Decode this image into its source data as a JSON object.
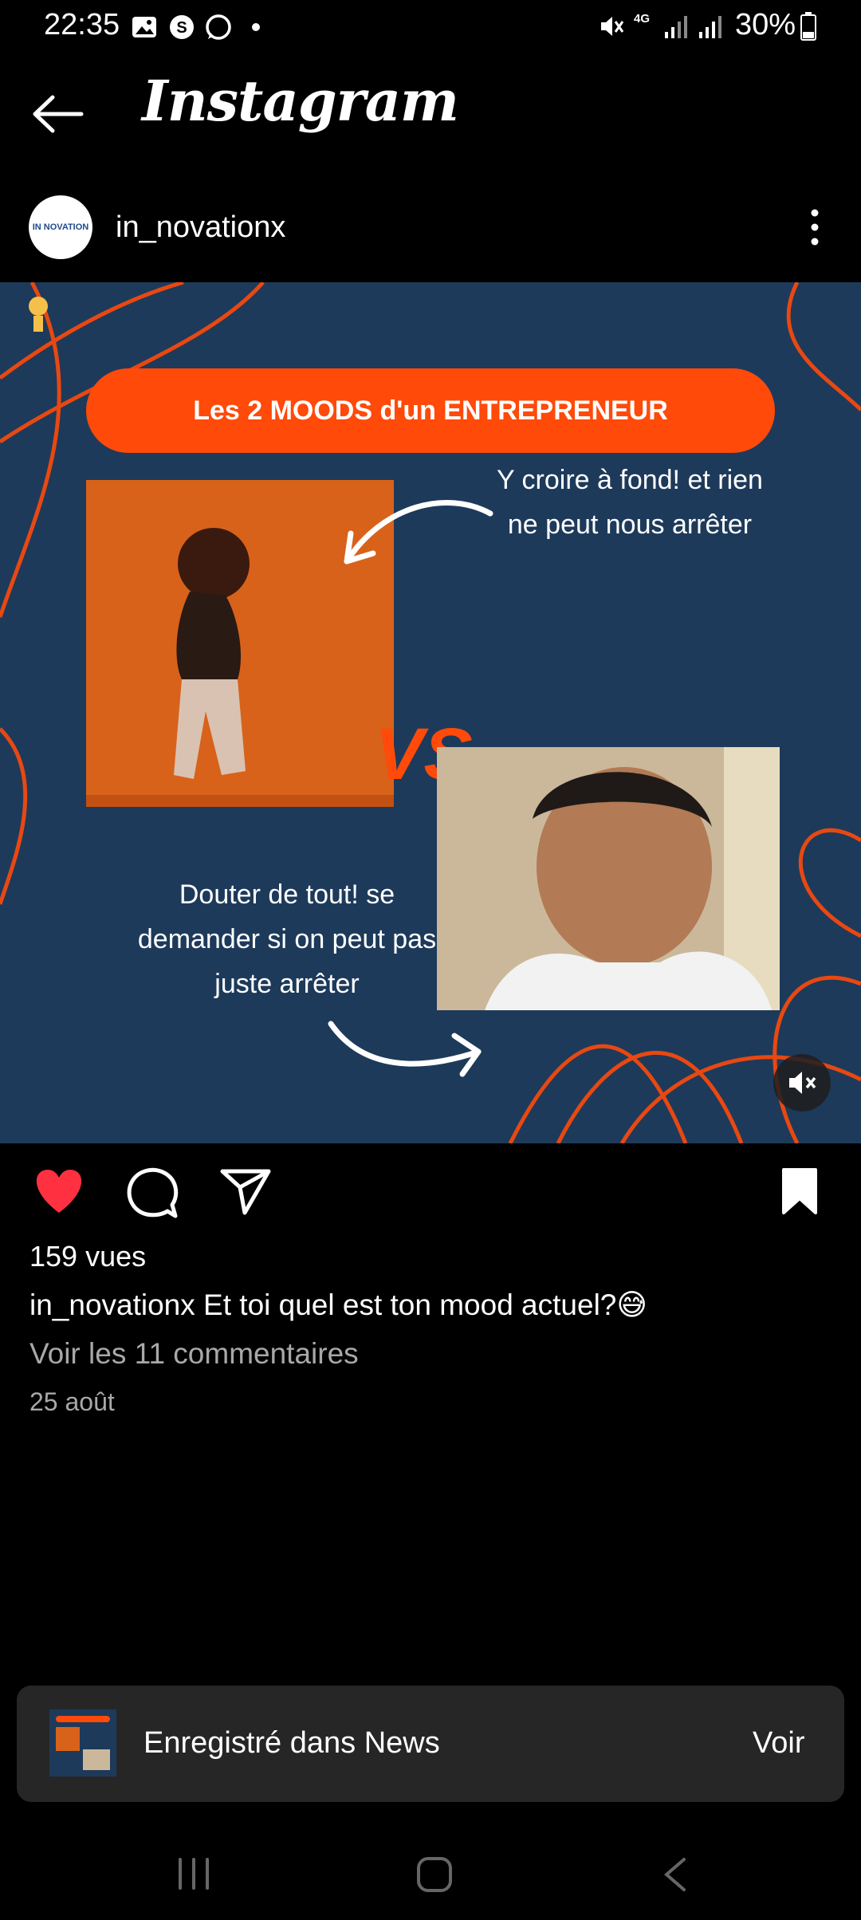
{
  "status_bar": {
    "time": "22:35",
    "network": "4G",
    "battery": "30%"
  },
  "header": {
    "title": "Instagram"
  },
  "post": {
    "author": "in_novationx",
    "avatar_text": "IN NOVATION",
    "media": {
      "banner": "Les 2 MOODS d'un ENTREPRENEUR",
      "caption_top": "Y croire à fond! et rien ne peut nous arrêter",
      "caption_bottom": "Douter de tout! se demander si on peut pas juste arrêter",
      "vs": "VS"
    },
    "views": "159 vues",
    "caption_user": "in_novationx",
    "caption_text": " Et toi quel est ton mood actuel?😅",
    "view_comments": "Voir les 11 commentaires",
    "date": "25 août"
  },
  "snackbar": {
    "text": "Enregistré dans News",
    "action": "Voir"
  },
  "colors": {
    "like": "#ff3040",
    "accent_orange": "#ff4a0a",
    "media_bg": "#1d3a5a"
  }
}
